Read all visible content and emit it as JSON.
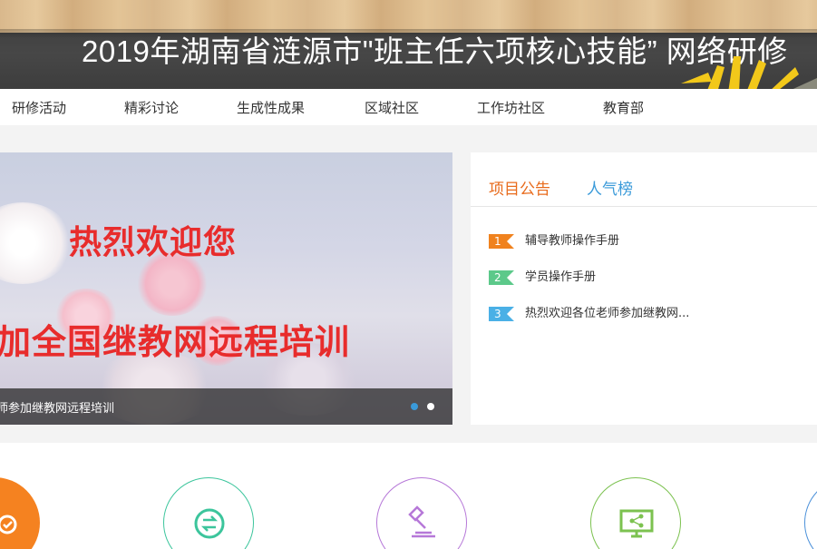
{
  "header": {
    "title": "2019年湖南省涟源市\"班主任六项核心技能”  网络研修"
  },
  "nav": {
    "items": [
      {
        "label": "研修活动"
      },
      {
        "label": "精彩讨论"
      },
      {
        "label": "生成性成果"
      },
      {
        "label": "区域社区"
      },
      {
        "label": "工作坊社区"
      },
      {
        "label": "教育部"
      }
    ]
  },
  "carousel": {
    "line1": "热烈欢迎您",
    "line2": "加全国继教网远程培训",
    "caption": "师参加继教网远程培训",
    "active_slide": 1,
    "slide_count": 2
  },
  "notice": {
    "tabs": [
      {
        "label": "项目公告",
        "active": true
      },
      {
        "label": "人气榜",
        "active": false
      }
    ],
    "items": [
      {
        "num": "1",
        "text": "辅导教师操作手册",
        "color": "#f0821e"
      },
      {
        "num": "2",
        "text": "学员操作手册",
        "color": "#5cc98a"
      },
      {
        "num": "3",
        "text": "热烈欢迎各位老师参加继教网...",
        "color": "#4ab0e6"
      }
    ]
  },
  "features": {
    "icons": [
      {
        "name": "certificate-icon",
        "color": "#f58220"
      },
      {
        "name": "exchange-icon",
        "color": "#3cc59c"
      },
      {
        "name": "gavel-icon",
        "color": "#b678d8"
      },
      {
        "name": "monitor-share-icon",
        "color": "#7cc250"
      },
      {
        "name": "circle-icon",
        "color": "#4a90d9"
      }
    ]
  },
  "colors": {
    "accent_orange": "#e86b1c",
    "accent_blue": "#3a9ad9",
    "title_red": "#e82c2c"
  }
}
